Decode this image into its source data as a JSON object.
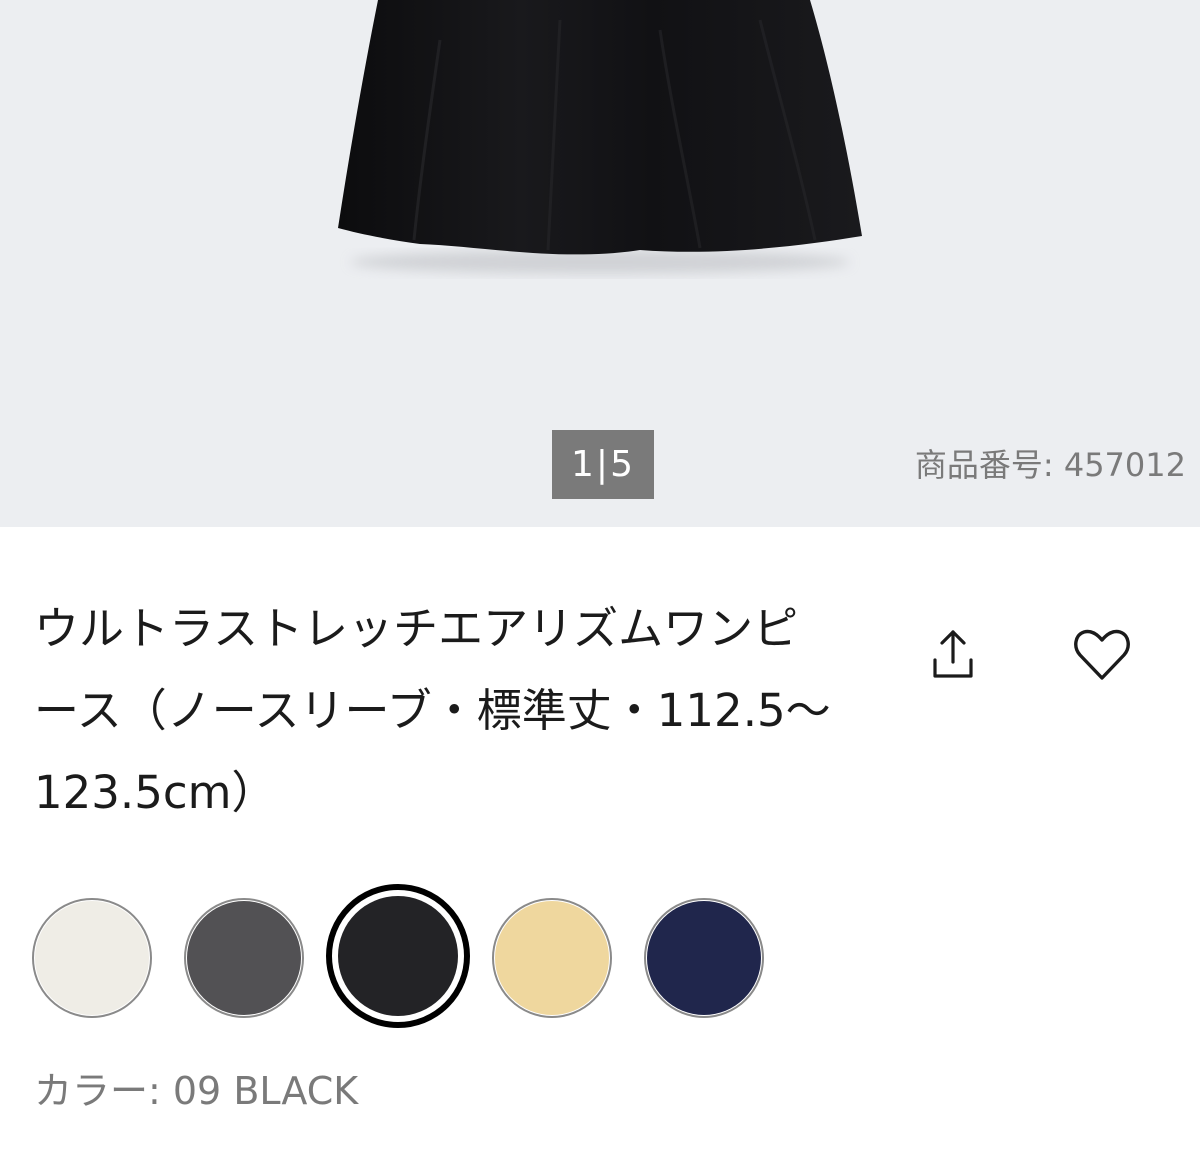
{
  "gallery": {
    "page_indicator": "1|5",
    "product_number": "商品番号: 457012"
  },
  "product": {
    "title": "ウルトラストレッチエアリズムワンピース（ノースリーブ・標準丈・112.5～123.5cm）"
  },
  "icons": {
    "share": "share-icon",
    "favorite": "heart-icon"
  },
  "colors": {
    "swatches": [
      {
        "name": "off-white",
        "hex": "#efede6",
        "selected": false
      },
      {
        "name": "gray",
        "hex": "#525154",
        "selected": false
      },
      {
        "name": "black",
        "hex": "#232326",
        "selected": true
      },
      {
        "name": "yellow",
        "hex": "#efd79e",
        "selected": false
      },
      {
        "name": "navy",
        "hex": "#20264c",
        "selected": false
      }
    ],
    "selected_label": "カラー: 09 BLACK"
  }
}
